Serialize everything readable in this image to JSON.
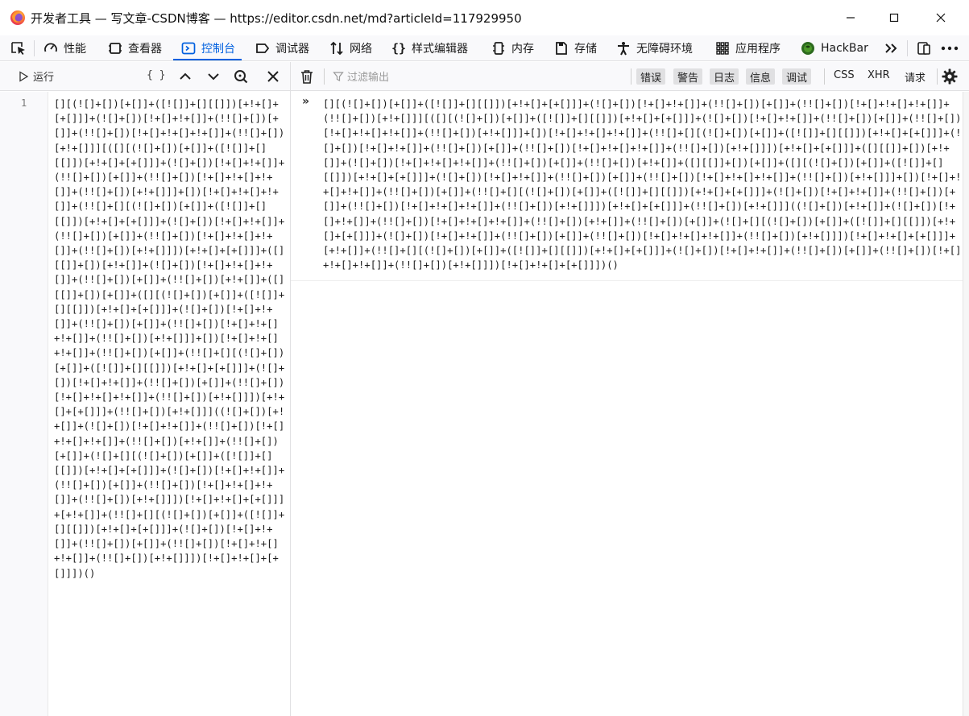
{
  "window": {
    "title": "开发者工具 — 写文章-CSDN博客 — https://editor.csdn.net/md?articleId=117929950"
  },
  "tabs": [
    {
      "label": "性能",
      "icon": "gauge-icon"
    },
    {
      "label": "查看器",
      "icon": "inspector-icon"
    },
    {
      "label": "控制台",
      "icon": "console-icon",
      "selected": true
    },
    {
      "label": "调试器",
      "icon": "debugger-icon"
    },
    {
      "label": "网络",
      "icon": "network-icon"
    },
    {
      "label": "样式编辑器",
      "icon": "braces-icon"
    },
    {
      "label": "内存",
      "icon": "memory-icon"
    },
    {
      "label": "存储",
      "icon": "storage-icon"
    },
    {
      "label": "无障碍环境",
      "icon": "accessibility-icon"
    },
    {
      "label": "应用程序",
      "icon": "application-icon"
    },
    {
      "label": "HackBar",
      "icon": "hackbar-icon"
    }
  ],
  "editor": {
    "run_label": "运行",
    "pretty_label": "{ }",
    "line_number": "1",
    "code": "[][(![]+[])[+[]]+([![]]+[][[]])[+!+[]+[+[]]]+(![]+[])[!+[]+!+[]]+(!![]+[])[+[]]+(!![]+[])[!+[]+!+[]+!+[]]+(!![]+[])[+!+[]]][([][(![]+[])[+[]]+([![]]+[][[]])[+!+[]+[+[]]]+(![]+[])[!+[]+!+[]]+(!![]+[])[+[]]+(!![]+[])[!+[]+!+[]+!+[]]+(!![]+[])[+!+[]]]+[])[!+[]+!+[]+!+[]]+(!![]+[][(![]+[])[+[]]+([![]]+[][[]])[+!+[]+[+[]]]+(![]+[])[!+[]+!+[]]+(!![]+[])[+[]]+(!![]+[])[!+[]+!+[]+!+[]]+(!![]+[])[+!+[]]])[+!+[]+[+[]]]+([][[]]+[])[+!+[]]+(![]+[])[!+[]+!+[]+!+[]]+(!![]+[])[+[]]+(!![]+[])[+!+[]]+([][[]]+[])[+[]]+([][(![]+[])[+[]]+([![]]+[][[]])[+!+[]+[+[]]]+(![]+[])[!+[]+!+[]]+(!![]+[])[+[]]+(!![]+[])[!+[]+!+[]+!+[]]+(!![]+[])[+!+[]]]+[])[!+[]+!+[]+!+[]]+(!![]+[])[+[]]+(!![]+[][(![]+[])[+[]]+([![]]+[][[]])[+!+[]+[+[]]]+(![]+[])[!+[]+!+[]]+(!![]+[])[+[]]+(!![]+[])[!+[]+!+[]+!+[]]+(!![]+[])[+!+[]]])[+!+[]+[+[]]]+(!![]+[])[+!+[]]]((![]+[])[+!+[]]+(![]+[])[!+[]+!+[]]+(!![]+[])[!+[]+!+[]+!+[]]+(!![]+[])[+!+[]]+(!![]+[])[+[]]+(![]+[][(![]+[])[+[]]+([![]]+[][[]])[+!+[]+[+[]]]+(![]+[])[!+[]+!+[]]+(!![]+[])[+[]]+(!![]+[])[!+[]+!+[]+!+[]]+(!![]+[])[+!+[]]])[!+[]+!+[]+[+[]]]+[+!+[]]+(!![]+[][(![]+[])[+[]]+([![]]+[][[]])[+!+[]+[+[]]]+(![]+[])[!+[]+!+[]]+(!![]+[])[+[]]+(!![]+[])[!+[]+!+[]+!+[]]+(!![]+[])[+!+[]]])[!+[]+!+[]+[+[]]])()"
  },
  "console": {
    "clear_icon": "trash-icon",
    "filter_placeholder": "过滤输出",
    "levels": [
      "错误",
      "警告",
      "日志",
      "信息",
      "调试"
    ],
    "categories": [
      "CSS",
      "XHR",
      "请求"
    ],
    "prompt": "»",
    "output": "[][(![]+[])[+[]]+([![]]+[][[]])[+!+[]+[+[]]]+(![]+[])[!+[]+!+[]]+(!![]+[])[+[]]+(!![]+[])[!+[]+!+[]+!+[]]+(!![]+[])[+!+[]]][([][(![]+[])[+[]]+([![]]+[][[]])[+!+[]+[+[]]]+(![]+[])[!+[]+!+[]]+(!![]+[])[+[]]+(!![]+[])[!+[]+!+[]+!+[]]+(!![]+[])[+!+[]]]+[])[!+[]+!+[]+!+[]]+(!![]+[][(![]+[])[+[]]+([![]]+[][[]])[+!+[]+[+[]]]+(![]+[])[!+[]+!+[]]+(!![]+[])[+[]]+(!![]+[])[!+[]+!+[]+!+[]]+(!![]+[])[+!+[]]])[+!+[]+[+[]]]+([][[]]+[])[+!+[]]+(![]+[])[!+[]+!+[]+!+[]]+(!![]+[])[+[]]+(!![]+[])[+!+[]]+([][[]]+[])[+[]]+([][(![]+[])[+[]]+([![]]+[][[]])[+!+[]+[+[]]]+(![]+[])[!+[]+!+[]]+(!![]+[])[+[]]+(!![]+[])[!+[]+!+[]+!+[]]+(!![]+[])[+!+[]]]+[])[!+[]+!+[]+!+[]]+(!![]+[])[+[]]+(!![]+[][(![]+[])[+[]]+([![]]+[][[]])[+!+[]+[+[]]]+(![]+[])[!+[]+!+[]]+(!![]+[])[+[]]+(!![]+[])[!+[]+!+[]+!+[]]+(!![]+[])[+!+[]]])[+!+[]+[+[]]]+(!![]+[])[+!+[]]]((![]+[])[+!+[]]+(![]+[])[!+[]+!+[]]+(!![]+[])[!+[]+!+[]+!+[]]+(!![]+[])[+!+[]]+(!![]+[])[+[]]+(![]+[][(![]+[])[+[]]+([![]]+[][[]])[+!+[]+[+[]]]+(![]+[])[!+[]+!+[]]+(!![]+[])[+[]]+(!![]+[])[!+[]+!+[]+!+[]]+(!![]+[])[+!+[]]])[!+[]+!+[]+[+[]]]+[+!+[]]+(!![]+[][(![]+[])[+[]]+([![]]+[][[]])[+!+[]+[+[]]]+(![]+[])[!+[]+!+[]]+(!![]+[])[+[]]+(!![]+[])[!+[]+!+[]+!+[]]+(!![]+[])[+!+[]]])[!+[]+!+[]+[+[]]])()"
  },
  "colors": {
    "accent": "#0060df",
    "toolbar_bg": "#f9f9fb",
    "level_bg": "#e0e0e2"
  }
}
